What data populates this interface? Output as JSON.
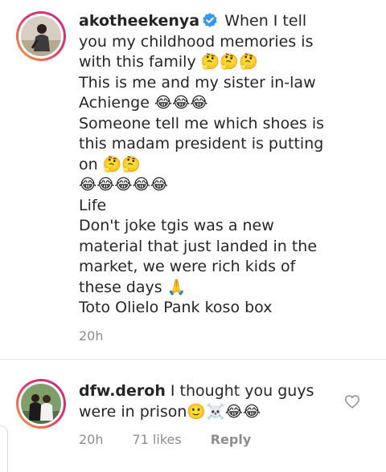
{
  "comments": [
    {
      "username": "akotheekenya",
      "verified": true,
      "text": "When I tell you my childhood memories is with this family 🤔🤔🤔\nThis is me and my sister in-law Achienge 😂😂😂\nSomeone tell me which shoes is this madam president is putting on 🤔🤔\n😂😂😂😂😂\nLife\nDon't joke tgis was a new material that just landed in the market, we were rich kids of these days 🙏\nToto Olielo Pank koso box",
      "time": "20h"
    },
    {
      "username": "dfw.deroh",
      "verified": false,
      "text": "I thought you guys were in prison🙂☠️😂😂",
      "time": "20h",
      "likes": "71 likes",
      "reply_label": "Reply"
    }
  ],
  "icons": {
    "verified": "verified-badge-icon",
    "like": "heart-outline-icon"
  },
  "colors": {
    "verified_blue": "#3897f0",
    "meta_gray": "#8e8e8e"
  }
}
